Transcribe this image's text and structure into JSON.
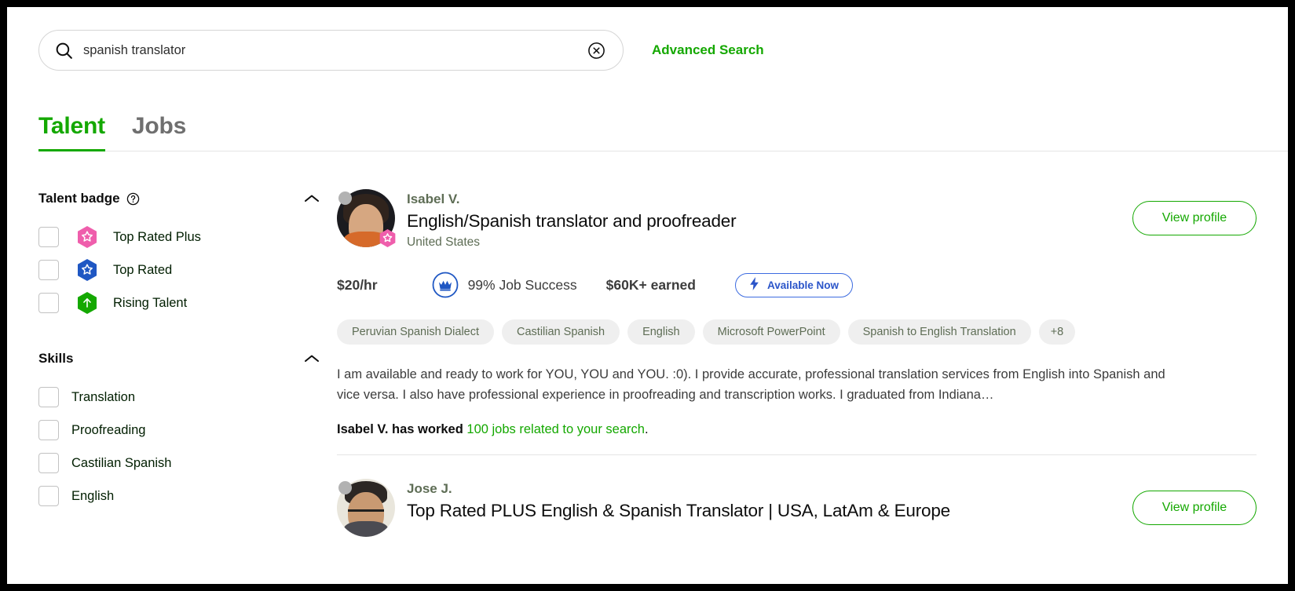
{
  "search": {
    "value": "spanish translator",
    "placeholder": "Search for talent",
    "search_icon": "search-icon",
    "clear_icon": "clear-circle-x-icon",
    "advanced_search_label": "Advanced Search"
  },
  "tabs": [
    {
      "label": "Talent",
      "active": true
    },
    {
      "label": "Jobs",
      "active": false
    }
  ],
  "sidebar": {
    "talent_badge": {
      "title": "Talent badge",
      "help_icon": "question-circle-icon",
      "collapse_icon": "chevron-up-icon",
      "items": [
        {
          "label": "Top Rated Plus",
          "badge_icon": "hexagon-star-pink-icon",
          "color": "#ef5eac",
          "checked": false
        },
        {
          "label": "Top Rated",
          "badge_icon": "hexagon-star-blue-icon",
          "color": "#1f57c3",
          "checked": false
        },
        {
          "label": "Rising Talent",
          "badge_icon": "hexagon-arrow-up-green-icon",
          "color": "#14a800",
          "checked": false
        }
      ]
    },
    "skills": {
      "title": "Skills",
      "collapse_icon": "chevron-up-icon",
      "items": [
        {
          "label": "Translation",
          "checked": false
        },
        {
          "label": "Proofreading",
          "checked": false
        },
        {
          "label": "Castilian Spanish",
          "checked": false
        },
        {
          "label": "English",
          "checked": false
        }
      ]
    }
  },
  "results": [
    {
      "name": "Isabel V.",
      "title": "English/Spanish translator and proofreader",
      "location": "United States",
      "badge_icon": "hexagon-star-pink-icon",
      "status_icon": "offline-status-dot",
      "view_profile_label": "View profile",
      "rate": "$20/hr",
      "job_success_icon": "crown-circle-icon",
      "job_success": "99% Job Success",
      "earned": "$60K+ earned",
      "available_icon": "lightning-bolt-icon",
      "available_label": "Available Now",
      "tags": [
        "Peruvian Spanish Dialect",
        "Castilian Spanish",
        "English",
        "Microsoft PowerPoint",
        "Spanish to English Translation"
      ],
      "tags_more": "+8",
      "description": "I am available and ready to work for YOU, YOU and YOU. :0). I provide accurate, professional translation services from English into Spanish and vice versa. I also have professional experience in proofreading and transcription works. I graduated from Indiana…",
      "worked_prefix": "Isabel V. has worked ",
      "worked_link": "100 jobs related to your search",
      "worked_suffix": "."
    },
    {
      "name": "Jose J.",
      "title": "Top Rated PLUS English & Spanish Translator | USA, LatAm & Europe",
      "status_icon": "offline-status-dot",
      "view_profile_label": "View profile"
    }
  ],
  "colors": {
    "accent_green": "#14a800",
    "available_blue": "#2b55c9",
    "badge_pink": "#ef5eac",
    "badge_blue": "#1f57c3",
    "badge_green": "#14a800"
  }
}
